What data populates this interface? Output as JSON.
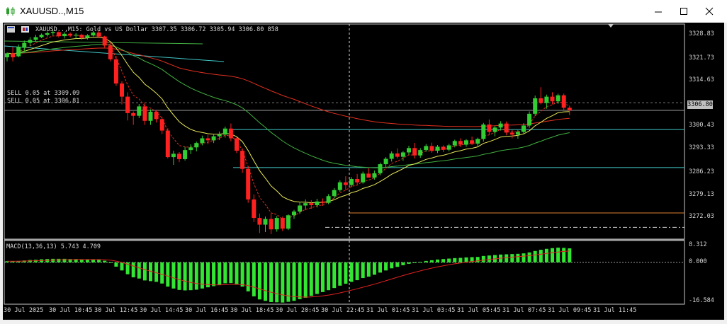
{
  "window": {
    "title": "XAUUSD..,M15",
    "controls": [
      "minimize-icon",
      "maximize-icon",
      "close-icon"
    ]
  },
  "chart": {
    "header_text": "XAUUSD..,M15:  Gold vs US Dollar  3307.35 3306.72 3305.94 3306.80  858",
    "symbol": "XAUUSD..",
    "timeframe": "M15",
    "orders": [
      {
        "label": "SELL 0.05 at 3309.09"
      },
      {
        "label": "SELL 0.05 at 3306.81"
      }
    ],
    "current_price": "3306.80",
    "price_axis": [
      "3328.83",
      "3321.73",
      "3314.63",
      "3300.43",
      "3293.33",
      "3286.23",
      "3279.13",
      "3272.03"
    ],
    "macd": {
      "label": "MACD(13,36,13) 5.743 4.709",
      "axis": [
        "8.312",
        "0.000",
        "-16.584"
      ]
    },
    "time_axis": [
      "30 Jul 2025",
      "30 Jul 10:45",
      "30 Jul 12:45",
      "30 Jul 14:45",
      "30 Jul 16:45",
      "30 Jul 18:45",
      "30 Jul 20:45",
      "30 Jul 22:45",
      "31 Jul 01:45",
      "31 Jul 03:45",
      "31 Jul 05:45",
      "31 Jul 07:45",
      "31 Jul 09:45",
      "31 Jul 11:45"
    ],
    "colors": {
      "background": "#000000",
      "bull": "#32cd32",
      "bear": "#ff2020",
      "ma_red": "#e03020",
      "ma_green": "#40b040",
      "ma_yellow": "#e8e858",
      "ma_dotted": "#e03020",
      "level_cyan": "#40c8c8",
      "level_orange": "#e08030",
      "macd_hist": "#32e632",
      "macd_signal": "#e02020"
    }
  },
  "chart_data": {
    "type": "candlestick",
    "y_range": [
      3268.5,
      3332.5
    ],
    "candles": [
      [
        3322.6,
        3324.0,
        3321.4,
        3323.8
      ],
      [
        3323.8,
        3325.7,
        3321.4,
        3322.6
      ],
      [
        3322.9,
        3326.4,
        3322.6,
        3325.7
      ],
      [
        3325.5,
        3327.6,
        3324.2,
        3326.9
      ],
      [
        3326.9,
        3328.6,
        3325.9,
        3327.8
      ],
      [
        3327.8,
        3329.3,
        3327.1,
        3328.6
      ],
      [
        3328.6,
        3329.7,
        3328.3,
        3329.3
      ],
      [
        3329.3,
        3330.3,
        3328.8,
        3329.8
      ],
      [
        3329.8,
        3330.6,
        3329.1,
        3330.1
      ],
      [
        3330.1,
        3330.3,
        3328.5,
        3328.9
      ],
      [
        3328.9,
        3330.1,
        3328.2,
        3329.6
      ],
      [
        3329.6,
        3330.0,
        3328.6,
        3329.1
      ],
      [
        3329.1,
        3329.8,
        3328.1,
        3329.3
      ],
      [
        3329.3,
        3329.6,
        3327.8,
        3328.4
      ],
      [
        3328.4,
        3329.5,
        3327.9,
        3329.1
      ],
      [
        3329.1,
        3330.4,
        3328.8,
        3330.0
      ],
      [
        3330.0,
        3330.6,
        3328.3,
        3328.8
      ],
      [
        3328.8,
        3329.0,
        3325.5,
        3326.1
      ],
      [
        3326.1,
        3327.1,
        3321.4,
        3322.0
      ],
      [
        3322.0,
        3323.0,
        3314.1,
        3314.8
      ],
      [
        3314.8,
        3315.5,
        3308.6,
        3310.9
      ],
      [
        3310.9,
        3312.2,
        3303.8,
        3306.0
      ],
      [
        3306.0,
        3306.5,
        3302.5,
        3305.2
      ],
      [
        3305.2,
        3308.7,
        3304.5,
        3308.0
      ],
      [
        3308.0,
        3309.0,
        3302.5,
        3303.7
      ],
      [
        3303.7,
        3307.1,
        3302.5,
        3306.4
      ],
      [
        3306.4,
        3306.8,
        3303.2,
        3304.2
      ],
      [
        3304.2,
        3304.8,
        3299.8,
        3300.8
      ],
      [
        3300.8,
        3301.5,
        3292.5,
        3292.9
      ],
      [
        3292.9,
        3294.8,
        3290.6,
        3293.9
      ],
      [
        3293.9,
        3294.4,
        3291.4,
        3292.3
      ],
      [
        3292.3,
        3296.0,
        3291.9,
        3295.0
      ],
      [
        3295.0,
        3296.7,
        3293.8,
        3295.8
      ],
      [
        3295.8,
        3297.5,
        3294.6,
        3297.1
      ],
      [
        3297.1,
        3299.3,
        3296.4,
        3298.5
      ],
      [
        3298.5,
        3299.5,
        3296.7,
        3297.9
      ],
      [
        3297.9,
        3299.8,
        3297.1,
        3299.1
      ],
      [
        3299.1,
        3300.5,
        3298.0,
        3299.6
      ],
      [
        3299.6,
        3302.0,
        3298.7,
        3301.4
      ],
      [
        3301.4,
        3302.9,
        3297.6,
        3298.5
      ],
      [
        3298.5,
        3298.8,
        3294.1,
        3294.8
      ],
      [
        3294.8,
        3295.5,
        3288.2,
        3289.4
      ],
      [
        3289.4,
        3290.2,
        3279.3,
        3280.3
      ],
      [
        3280.3,
        3281.8,
        3273.6,
        3274.8
      ],
      [
        3274.8,
        3276.1,
        3270.3,
        3272.8
      ],
      [
        3272.8,
        3275.2,
        3270.6,
        3274.5
      ],
      [
        3274.5,
        3276.1,
        3270.0,
        3271.4
      ],
      [
        3271.4,
        3275.4,
        3270.7,
        3274.8
      ],
      [
        3274.8,
        3275.2,
        3270.9,
        3271.6
      ],
      [
        3271.6,
        3275.9,
        3271.2,
        3275.6
      ],
      [
        3275.6,
        3277.2,
        3274.5,
        3276.7
      ],
      [
        3276.7,
        3279.6,
        3276.0,
        3278.5
      ],
      [
        3278.5,
        3280.3,
        3277.2,
        3279.2
      ],
      [
        3279.2,
        3280.1,
        3277.5,
        3278.6
      ],
      [
        3278.6,
        3280.5,
        3277.9,
        3279.7
      ],
      [
        3279.7,
        3280.6,
        3278.4,
        3279.3
      ],
      [
        3279.3,
        3281.9,
        3278.9,
        3281.3
      ],
      [
        3281.3,
        3283.7,
        3280.6,
        3283.1
      ],
      [
        3283.1,
        3286.0,
        3282.6,
        3285.4
      ],
      [
        3285.4,
        3287.2,
        3283.1,
        3284.6
      ],
      [
        3284.6,
        3287.0,
        3284.0,
        3286.4
      ],
      [
        3286.4,
        3287.9,
        3284.8,
        3285.4
      ],
      [
        3285.4,
        3288.6,
        3285.0,
        3288.0
      ],
      [
        3288.0,
        3289.6,
        3287.1,
        3286.8
      ],
      [
        3286.8,
        3288.9,
        3286.2,
        3288.1
      ],
      [
        3288.1,
        3291.3,
        3287.5,
        3290.8
      ],
      [
        3290.8,
        3292.9,
        3289.9,
        3292.4
      ],
      [
        3292.4,
        3294.6,
        3291.6,
        3294.0
      ],
      [
        3294.0,
        3295.5,
        3292.5,
        3293.0
      ],
      [
        3293.0,
        3294.7,
        3291.8,
        3294.3
      ],
      [
        3294.3,
        3296.3,
        3293.6,
        3295.6
      ],
      [
        3295.6,
        3297.1,
        3292.5,
        3293.4
      ],
      [
        3293.4,
        3295.6,
        3292.7,
        3295.0
      ],
      [
        3295.0,
        3296.8,
        3294.5,
        3296.2
      ],
      [
        3296.2,
        3297.2,
        3294.2,
        3294.8
      ],
      [
        3294.8,
        3296.5,
        3294.1,
        3296.0
      ],
      [
        3296.0,
        3296.4,
        3294.4,
        3295.1
      ],
      [
        3295.1,
        3296.9,
        3294.6,
        3296.4
      ],
      [
        3296.4,
        3298.1,
        3295.8,
        3297.7
      ],
      [
        3297.7,
        3298.5,
        3295.9,
        3296.6
      ],
      [
        3296.6,
        3298.3,
        3296.0,
        3297.9
      ],
      [
        3297.9,
        3299.0,
        3296.5,
        3296.9
      ],
      [
        3296.9,
        3298.7,
        3296.2,
        3298.3
      ],
      [
        3298.3,
        3303.1,
        3297.5,
        3302.6
      ],
      [
        3302.6,
        3304.1,
        3299.7,
        3300.4
      ],
      [
        3300.4,
        3302.2,
        3299.1,
        3301.7
      ],
      [
        3301.7,
        3303.6,
        3300.8,
        3302.9
      ],
      [
        3302.9,
        3303.5,
        3299.4,
        3300.2
      ],
      [
        3300.2,
        3301.0,
        3298.5,
        3299.6
      ],
      [
        3299.6,
        3300.9,
        3298.4,
        3300.4
      ],
      [
        3300.4,
        3303.0,
        3299.8,
        3302.3
      ],
      [
        3302.3,
        3306.5,
        3301.6,
        3305.8
      ],
      [
        3305.8,
        3311.2,
        3305.1,
        3310.4
      ],
      [
        3310.4,
        3313.7,
        3308.6,
        3309.0
      ],
      [
        3309.0,
        3311.5,
        3307.3,
        3310.9
      ],
      [
        3310.9,
        3312.2,
        3308.6,
        3309.5
      ],
      [
        3309.5,
        3311.8,
        3308.8,
        3311.3
      ],
      [
        3311.3,
        3311.8,
        3307.0,
        3307.6
      ],
      [
        3307.6,
        3308.2,
        3305.4,
        3306.8
      ]
    ],
    "macd_values": [
      0.5,
      0.5,
      0.6,
      0.8,
      1.0,
      1.1,
      1.3,
      1.4,
      1.5,
      1.5,
      1.5,
      1.4,
      1.4,
      1.3,
      1.2,
      1.2,
      1.1,
      0.7,
      -0.2,
      -1.8,
      -3.4,
      -5.0,
      -6.3,
      -6.8,
      -7.6,
      -7.9,
      -8.2,
      -8.9,
      -10.2,
      -11.0,
      -11.6,
      -11.8,
      -11.7,
      -11.5,
      -11.0,
      -10.5,
      -10.0,
      -9.5,
      -8.8,
      -8.7,
      -9.1,
      -10.2,
      -12.2,
      -14.3,
      -15.6,
      -16.2,
      -16.7,
      -16.8,
      -16.9,
      -16.6,
      -16.2,
      -15.5,
      -14.9,
      -14.1,
      -13.3,
      -12.5,
      -11.7,
      -10.8,
      -9.8,
      -9.0,
      -8.2,
      -7.5,
      -6.6,
      -6.0,
      -5.2,
      -4.3,
      -3.4,
      -2.5,
      -1.9,
      -1.2,
      -0.6,
      -0.3,
      0.2,
      0.6,
      0.9,
      1.2,
      1.4,
      1.6,
      1.8,
      1.9,
      2.1,
      2.2,
      2.3,
      2.7,
      2.9,
      3.1,
      3.3,
      3.4,
      3.5,
      3.6,
      3.8,
      4.2,
      4.8,
      5.3,
      5.7,
      6.0,
      6.2,
      6.1,
      5.9
    ],
    "macd_range": [
      -17.6,
      9.2
    ]
  }
}
